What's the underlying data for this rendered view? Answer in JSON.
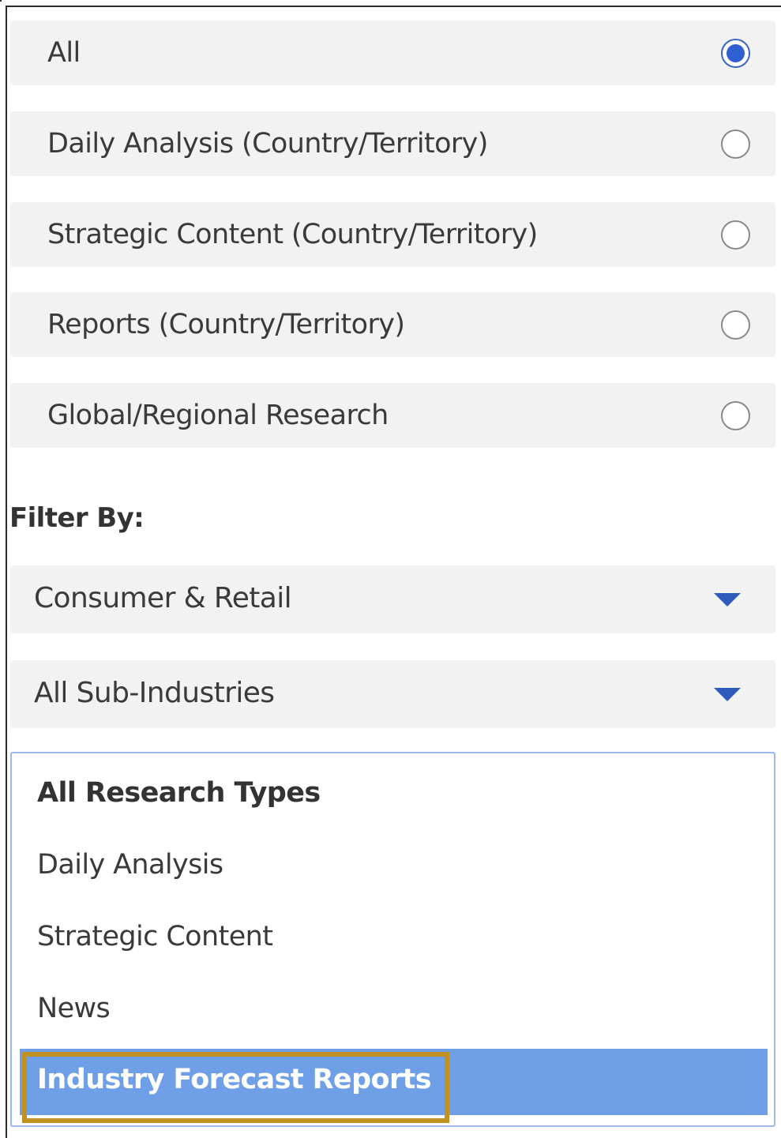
{
  "content_types": {
    "options": [
      {
        "label": "All",
        "checked": true
      },
      {
        "label": "Daily Analysis (Country/Territory)",
        "checked": false
      },
      {
        "label": "Strategic Content (Country/Territory)",
        "checked": false
      },
      {
        "label": "Reports (Country/Territory)",
        "checked": false
      },
      {
        "label": "Global/Regional Research",
        "checked": false
      }
    ]
  },
  "filter": {
    "title": "Filter By:",
    "industry_value": "Consumer & Retail",
    "sub_industry_value": "All Sub-Industries"
  },
  "research_types": {
    "options": [
      "All Research Types",
      "Daily Analysis",
      "Strategic Content",
      "News",
      "Industry Forecast Reports"
    ],
    "selected": "Industry Forecast Reports"
  },
  "colors": {
    "accent": "#2f5fd0",
    "selected_option_bg": "#6f9fe6",
    "highlight_outline": "#c09020",
    "row_bg": "#f2f2f2"
  }
}
